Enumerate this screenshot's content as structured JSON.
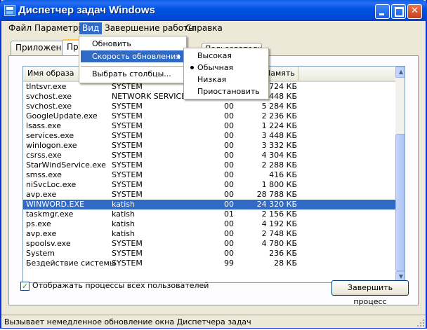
{
  "window": {
    "title": "Диспетчер задач Windows"
  },
  "menu": [
    "Файл",
    "Параметры",
    "Вид",
    "Завершение работы",
    "Справка"
  ],
  "tabs": [
    "Приложения",
    "Про",
    "Пользователи"
  ],
  "columns": {
    "name": "Имя образа",
    "memory": "Память"
  },
  "processes": [
    {
      "name": "tlntsvr.exe",
      "user": "SYSTEM",
      "cpu": "",
      "mem": "724 КБ"
    },
    {
      "name": "svchost.exe",
      "user": "NETWORK SERVICE",
      "cpu": "",
      "mem": "448 КБ"
    },
    {
      "name": "svchost.exe",
      "user": "SYSTEM",
      "cpu": "00",
      "mem": "5 284 КБ"
    },
    {
      "name": "GoogleUpdate.exe",
      "user": "SYSTEM",
      "cpu": "00",
      "mem": "2 236 КБ"
    },
    {
      "name": "lsass.exe",
      "user": "SYSTEM",
      "cpu": "00",
      "mem": "1 224 КБ"
    },
    {
      "name": "services.exe",
      "user": "SYSTEM",
      "cpu": "00",
      "mem": "3 448 КБ"
    },
    {
      "name": "winlogon.exe",
      "user": "SYSTEM",
      "cpu": "00",
      "mem": "3 332 КБ"
    },
    {
      "name": "csrss.exe",
      "user": "SYSTEM",
      "cpu": "00",
      "mem": "4 304 КБ"
    },
    {
      "name": "StarWindService.exe",
      "user": "SYSTEM",
      "cpu": "00",
      "mem": "2 288 КБ"
    },
    {
      "name": "smss.exe",
      "user": "SYSTEM",
      "cpu": "00",
      "mem": "416 КБ"
    },
    {
      "name": "niSvcLoc.exe",
      "user": "SYSTEM",
      "cpu": "00",
      "mem": "1 800 КБ"
    },
    {
      "name": "avp.exe",
      "user": "SYSTEM",
      "cpu": "00",
      "mem": "28 788 КБ"
    },
    {
      "name": "WINWORD.EXE",
      "user": "katish",
      "cpu": "00",
      "mem": "24 320 КБ",
      "selected": true
    },
    {
      "name": "taskmgr.exe",
      "user": "katish",
      "cpu": "01",
      "mem": "2 156 КБ"
    },
    {
      "name": "ps.exe",
      "user": "katish",
      "cpu": "00",
      "mem": "4 192 КБ"
    },
    {
      "name": "avp.exe",
      "user": "katish",
      "cpu": "00",
      "mem": "2 748 КБ"
    },
    {
      "name": "spoolsv.exe",
      "user": "SYSTEM",
      "cpu": "00",
      "mem": "4 780 КБ"
    },
    {
      "name": "System",
      "user": "SYSTEM",
      "cpu": "00",
      "mem": "236 КБ"
    },
    {
      "name": "Бездействие системы",
      "user": "SYSTEM",
      "cpu": "99",
      "mem": "28 КБ"
    }
  ],
  "show_all_label": "Отображать процессы всех пользователей",
  "end_process_label": "Завершить процесс",
  "status_text": "Вызывает немедленное обновление окна Диспетчера задач",
  "view_menu": {
    "refresh": "Обновить",
    "update_speed": "Скорость обновления",
    "select_columns": "Выбрать столбцы..."
  },
  "speed_menu": [
    "Высокая",
    "Обычная",
    "Низкая",
    "Приостановить"
  ],
  "speed_selected": "Обычная"
}
